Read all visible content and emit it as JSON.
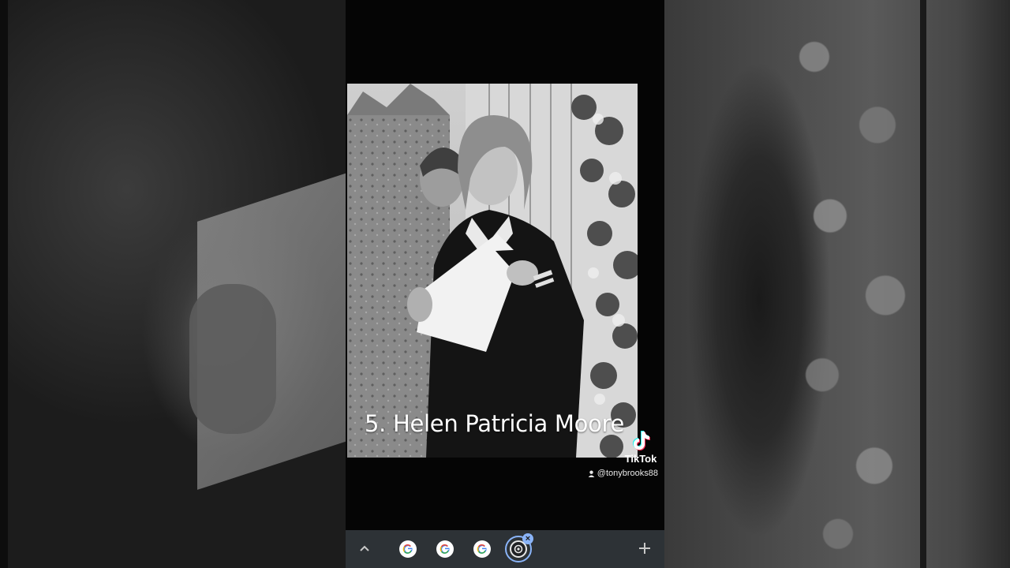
{
  "video": {
    "caption": "5. Helen Patricia Moore",
    "watermark": {
      "brand": "TikTok",
      "handle": "@tonybrooks88",
      "logo_icon": "tiktok-note-icon",
      "user_icon": "person-icon"
    }
  },
  "tabbar": {
    "expand_icon": "chevron-up-icon",
    "tabs": [
      {
        "icon": "google-g-icon"
      },
      {
        "icon": "google-g-icon"
      },
      {
        "icon": "google-g-icon"
      },
      {
        "icon": "active-tab-icon",
        "active": true,
        "close_label": "×"
      }
    ],
    "new_tab_icon": "plus-icon"
  },
  "colors": {
    "tabbar_bg": "#2d3236",
    "active_accent": "#8ab4f8",
    "caption_text": "#ffffff"
  }
}
